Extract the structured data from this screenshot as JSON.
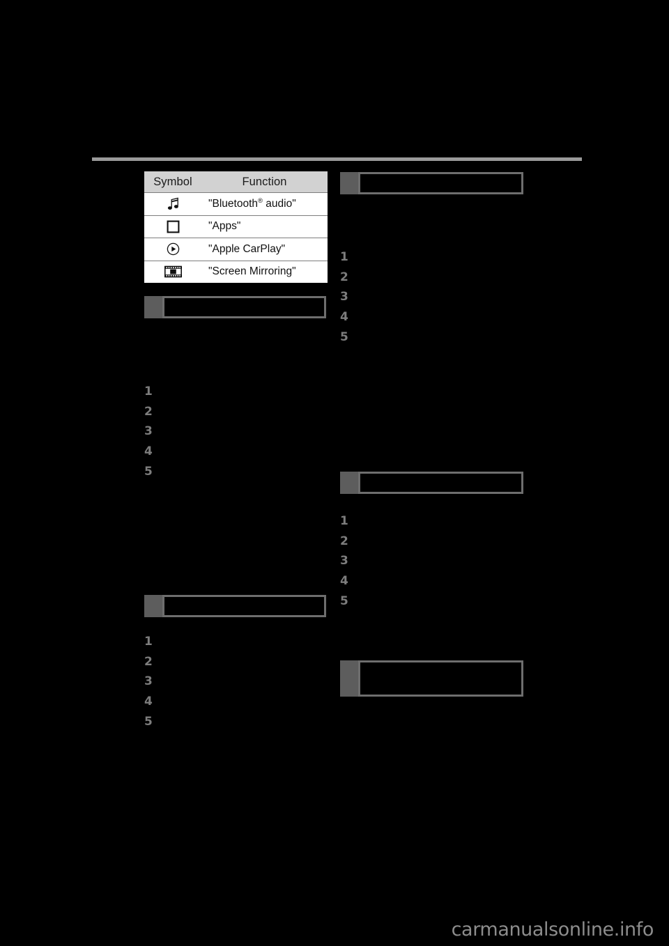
{
  "document": {
    "watermark": "carmanualsonline.info",
    "divider_present": true
  },
  "symbol_table": {
    "headers": {
      "symbol": "Symbol",
      "function": "Function"
    },
    "rows": [
      {
        "icon": "music-note-icon",
        "function": "\"Bluetooth",
        "sup": "®",
        "function_tail": " audio\""
      },
      {
        "icon": "square-icon",
        "function": "\"Apps\"",
        "sup": "",
        "function_tail": ""
      },
      {
        "icon": "play-circle-icon",
        "function": "\"Apple CarPlay\"",
        "sup": "",
        "function_tail": ""
      },
      {
        "icon": "film-strip-icon",
        "function": "\"Screen Mirroring\"",
        "sup": "",
        "function_tail": ""
      }
    ]
  },
  "left_column": {
    "section_1": {
      "heading": "",
      "body": "",
      "steps": [
        "1",
        "2",
        "3",
        "4",
        "5"
      ]
    },
    "section_2": {
      "heading": "",
      "body": "",
      "steps": [
        "1",
        "2",
        "3",
        "4",
        "5"
      ]
    }
  },
  "right_column": {
    "section_1": {
      "heading": "",
      "body": "",
      "steps": [
        "1",
        "2",
        "3",
        "4",
        "5"
      ]
    },
    "section_2": {
      "heading": "",
      "body": "",
      "steps": [
        "1",
        "2",
        "3",
        "4",
        "5"
      ]
    },
    "section_3": {
      "heading": "",
      "body": ""
    }
  },
  "colors": {
    "page_background": "#000000",
    "rule": "#9a9a9a",
    "table_header_fill": "#d2d2d2",
    "table_fill": "#ffffff",
    "section_tab": "#5d5d5d",
    "section_border": "#6e6e6e",
    "step_marker": "#7d7d7d",
    "watermark": "#8c8c8c"
  }
}
